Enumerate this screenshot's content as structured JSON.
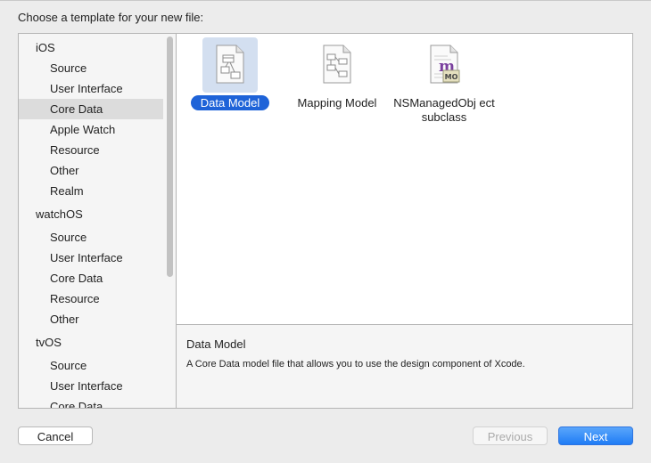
{
  "dialog": {
    "heading": "Choose a template for your new file:"
  },
  "sidebar": {
    "items": [
      {
        "label": "iOS",
        "kind": "group"
      },
      {
        "label": "Source",
        "kind": "child"
      },
      {
        "label": "User Interface",
        "kind": "child"
      },
      {
        "label": "Core Data",
        "kind": "child",
        "selected": true
      },
      {
        "label": "Apple Watch",
        "kind": "child"
      },
      {
        "label": "Resource",
        "kind": "child"
      },
      {
        "label": "Other",
        "kind": "child"
      },
      {
        "label": "Realm",
        "kind": "child"
      },
      {
        "label": "watchOS",
        "kind": "group"
      },
      {
        "label": "Source",
        "kind": "child"
      },
      {
        "label": "User Interface",
        "kind": "child"
      },
      {
        "label": "Core Data",
        "kind": "child"
      },
      {
        "label": "Resource",
        "kind": "child"
      },
      {
        "label": "Other",
        "kind": "child"
      },
      {
        "label": "tvOS",
        "kind": "group"
      },
      {
        "label": "Source",
        "kind": "child"
      },
      {
        "label": "User Interface",
        "kind": "child"
      },
      {
        "label": "Core Data",
        "kind": "child"
      }
    ]
  },
  "templates": [
    {
      "label": "Data Model",
      "icon": "data-model-icon",
      "selected": true
    },
    {
      "label": "Mapping Model",
      "icon": "mapping-model-icon",
      "selected": false
    },
    {
      "label": "NSManagedObj ect subclass",
      "icon": "managed-object-icon",
      "badge": "MO",
      "glyph": "m",
      "selected": false
    }
  ],
  "description": {
    "title": "Data Model",
    "text": "A Core Data model file that allows you to use the design component of Xcode."
  },
  "buttons": {
    "cancel": "Cancel",
    "previous": "Previous",
    "next": "Next"
  },
  "colors": {
    "accent": "#1e63d8",
    "selection_tile": "#d3dff0",
    "sidebar_selection": "#dcdcdc"
  }
}
